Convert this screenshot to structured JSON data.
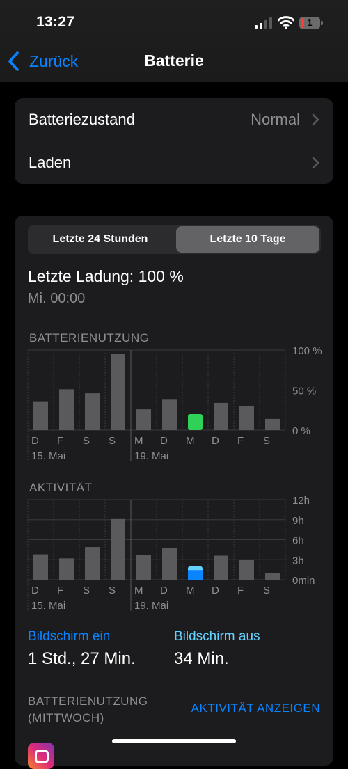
{
  "status_bar": {
    "time": "13:27",
    "battery_level": "1"
  },
  "nav": {
    "back_label": "Zurück",
    "title": "Batterie"
  },
  "settings": {
    "rows": [
      {
        "label": "Batteriezustand",
        "value": "Normal"
      },
      {
        "label": "Laden",
        "value": ""
      }
    ]
  },
  "segments": {
    "options": [
      "Letzte 24 Stunden",
      "Letzte 10 Tage"
    ],
    "selected": 1
  },
  "last_charge": {
    "label": "Letzte Ladung: 100 %",
    "time": "Mi. 00:00"
  },
  "usage_chart": {
    "title": "BATTERIENUTZUNG",
    "y_ticks": [
      "100 %",
      "50 %",
      "0 %"
    ],
    "days": [
      "D",
      "F",
      "S",
      "S",
      "M",
      "D",
      "M",
      "D",
      "F",
      "S"
    ],
    "date_labels": [
      "15. Mai",
      "19. Mai"
    ],
    "unit": "%",
    "values": [
      36,
      51,
      46,
      95,
      26,
      38,
      20,
      34,
      30,
      14
    ],
    "highlight_index": 6,
    "highlight_color": "#30d158",
    "bar_color": "#5a5a5c"
  },
  "activity_chart": {
    "title": "AKTIVITÄT",
    "y_ticks": [
      "12h",
      "9h",
      "6h",
      "3h",
      "0min"
    ],
    "days": [
      "D",
      "F",
      "S",
      "S",
      "M",
      "D",
      "M",
      "D",
      "F",
      "S"
    ],
    "date_labels": [
      "15. Mai",
      "19. Mai"
    ],
    "unit": "h",
    "values": [
      3.8,
      3.2,
      4.9,
      9.1,
      3.7,
      4.7,
      2.0,
      3.6,
      3.0,
      1.0
    ],
    "max": 12,
    "highlight_index": 6,
    "highlight_colors": [
      "#0a84ff",
      "#64d2ff"
    ],
    "bar_color": "#5a5a5c"
  },
  "screen": {
    "on_label": "Bildschirm ein",
    "on_value": "1 Std., 27 Min.",
    "off_label": "Bildschirm aus",
    "off_value": "34 Min.",
    "on_color": "#0a84ff",
    "off_color": "#64d2ff"
  },
  "footer": {
    "title_line1": "BATTERIENUTZUNG",
    "title_line2": "(MITTWOCH)",
    "link": "AKTIVITÄT ANZEIGEN"
  },
  "app_row": {
    "icon": "instagram-icon"
  }
}
